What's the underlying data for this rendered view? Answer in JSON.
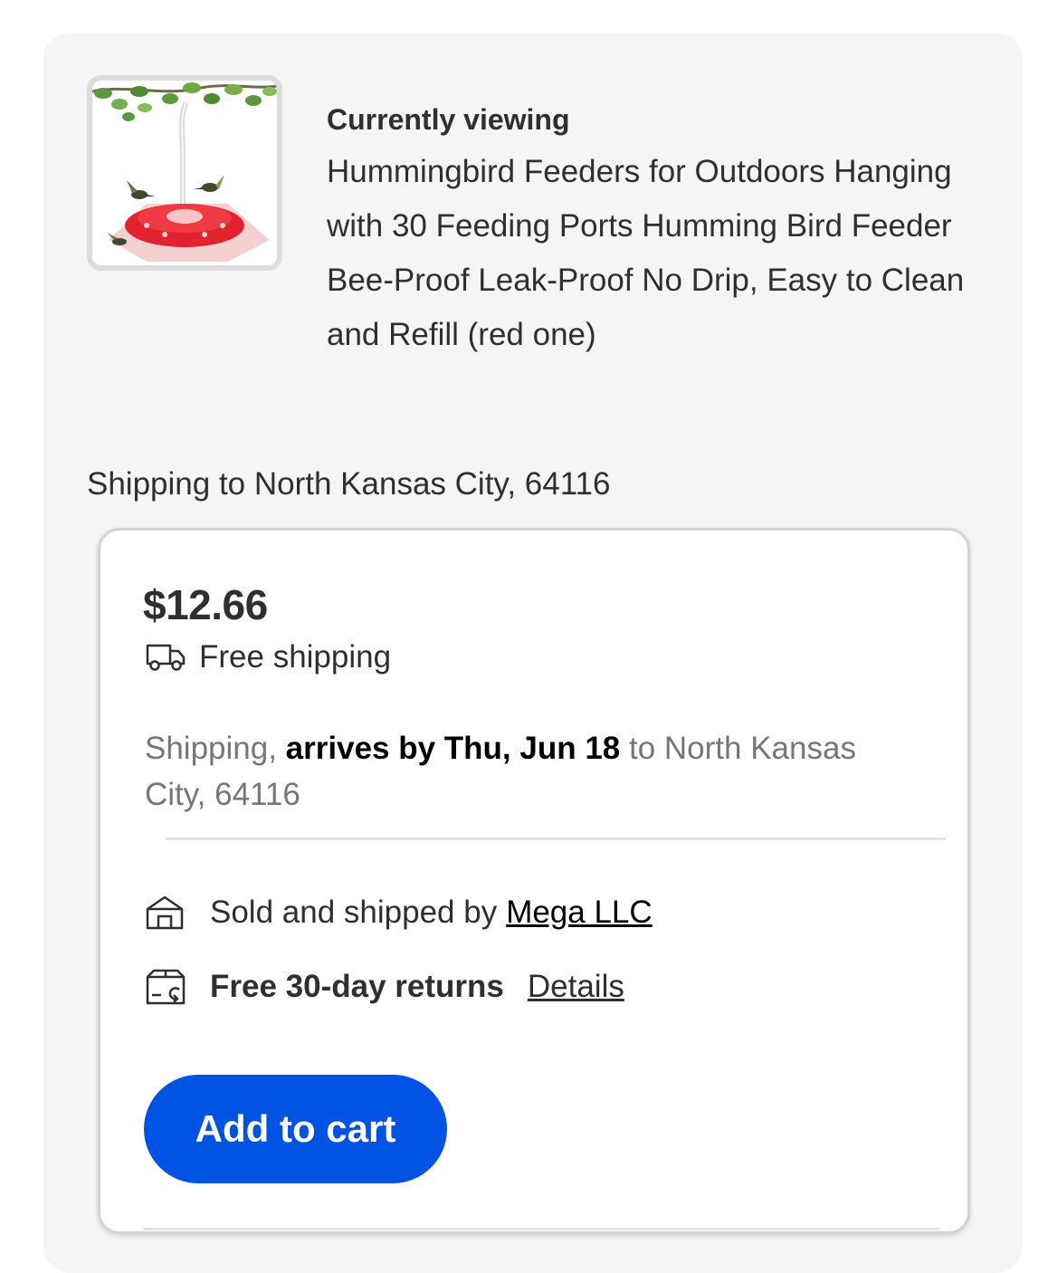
{
  "product": {
    "viewing_label": "Currently viewing",
    "title": "Hummingbird Feeders for Outdoors Hanging with 30 Feeding Ports Humming Bird Feeder Bee-Proof Leak-Proof No Drip, Easy to Clean and Refill (red one)",
    "image_icon": "hummingbird-feeder-image"
  },
  "shipping_location": "Shipping to North Kansas City, 64116",
  "offer": {
    "price": "$12.66",
    "free_shipping": "Free shipping",
    "arrival_prefix": "Shipping, ",
    "arrival_bold": "arrives by Thu, Jun 18",
    "arrival_suffix": " to North Kansas City, 64116",
    "sold_by_label": "Sold and shipped by",
    "seller": "Mega LLC",
    "returns": "Free 30-day returns",
    "details_link": "Details",
    "add_to_cart": "Add to cart"
  },
  "colors": {
    "accent_blue": "#0053e2",
    "panel_background": "#f5f5f5",
    "text_primary": "#2e2f32",
    "text_muted": "#74767c"
  }
}
